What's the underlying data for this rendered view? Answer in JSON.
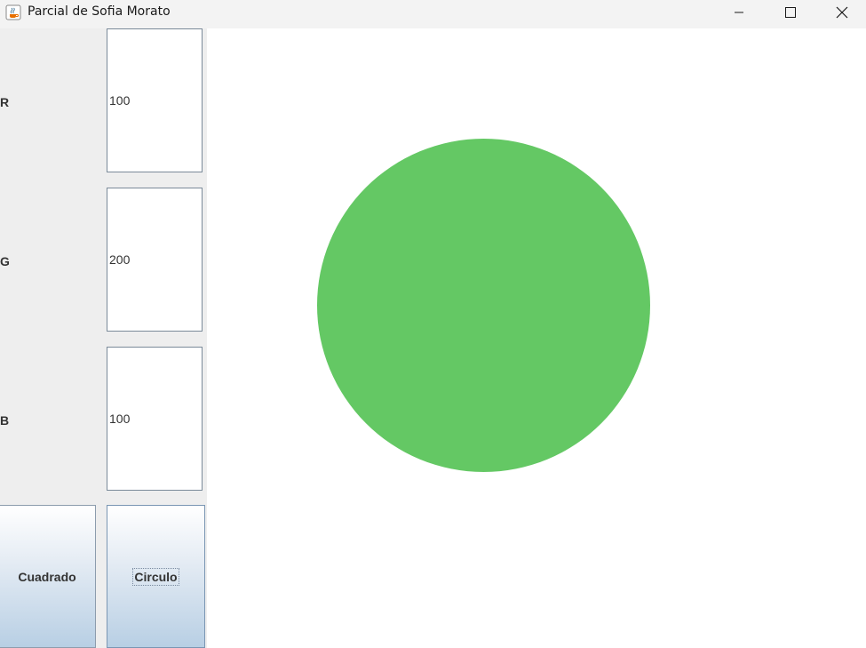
{
  "window": {
    "title": "Parcial de Sofia Morato"
  },
  "fields": [
    {
      "label": "R",
      "value": "100"
    },
    {
      "label": "G",
      "value": "200"
    },
    {
      "label": "B",
      "value": "100"
    }
  ],
  "buttons": {
    "square_label": "Cuadrado",
    "circle_label": "Circulo"
  },
  "canvas": {
    "shape": "circle",
    "fill_color": "#64c864"
  },
  "icons": {
    "app": "java-coffee-cup-icon",
    "minimize": "minimize-icon",
    "maximize": "maximize-icon",
    "close": "close-icon"
  }
}
